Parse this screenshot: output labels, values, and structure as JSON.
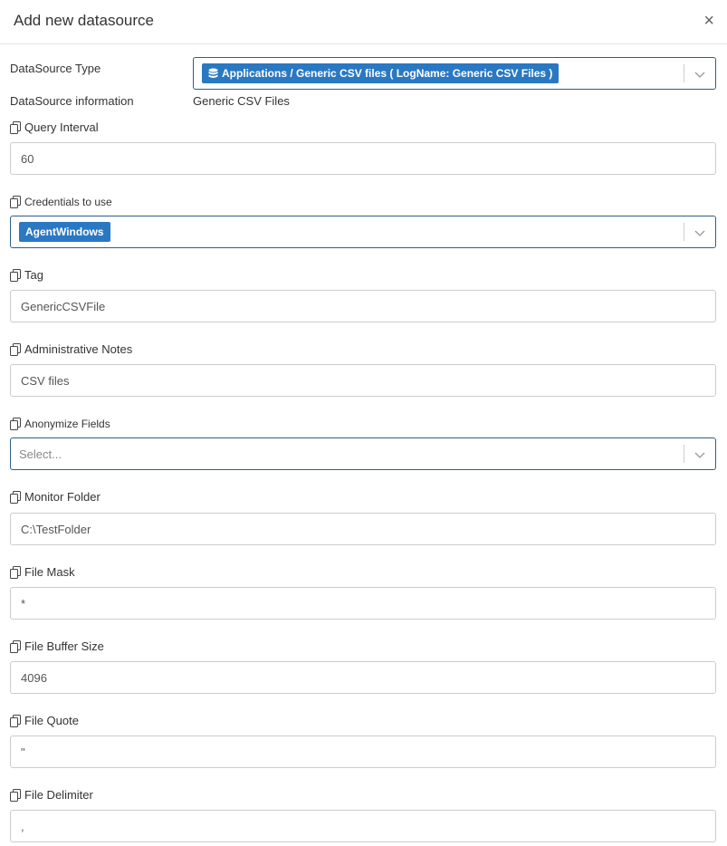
{
  "dialog": {
    "title": "Add new datasource",
    "close_label": "×"
  },
  "datasource_type": {
    "label": "DataSource Type",
    "selected": "Applications / Generic CSV files ( LogName: Generic CSV Files )"
  },
  "datasource_info": {
    "label": "DataSource information",
    "value": "Generic CSV Files"
  },
  "query_interval": {
    "label": "Query Interval",
    "value": "60"
  },
  "credentials": {
    "label": "Credentials to use",
    "selected": "AgentWindows"
  },
  "tag": {
    "label": "Tag",
    "value": "GenericCSVFile"
  },
  "admin_notes": {
    "label": "Administrative Notes",
    "value": "CSV files"
  },
  "anonymize": {
    "label": "Anonymize Fields",
    "placeholder": "Select..."
  },
  "monitor_folder": {
    "label": "Monitor Folder",
    "value": "C:\\TestFolder"
  },
  "file_mask": {
    "label": "File Mask",
    "value": "*"
  },
  "file_buffer_size": {
    "label": "File Buffer Size",
    "value": "4096"
  },
  "file_quote": {
    "label": "File Quote",
    "value": "\""
  },
  "file_delimiter": {
    "label": "File Delimiter",
    "value": ","
  },
  "colors": {
    "accent": "#2a78c2",
    "border_active": "#2b5f8c",
    "border": "#cccccc"
  }
}
